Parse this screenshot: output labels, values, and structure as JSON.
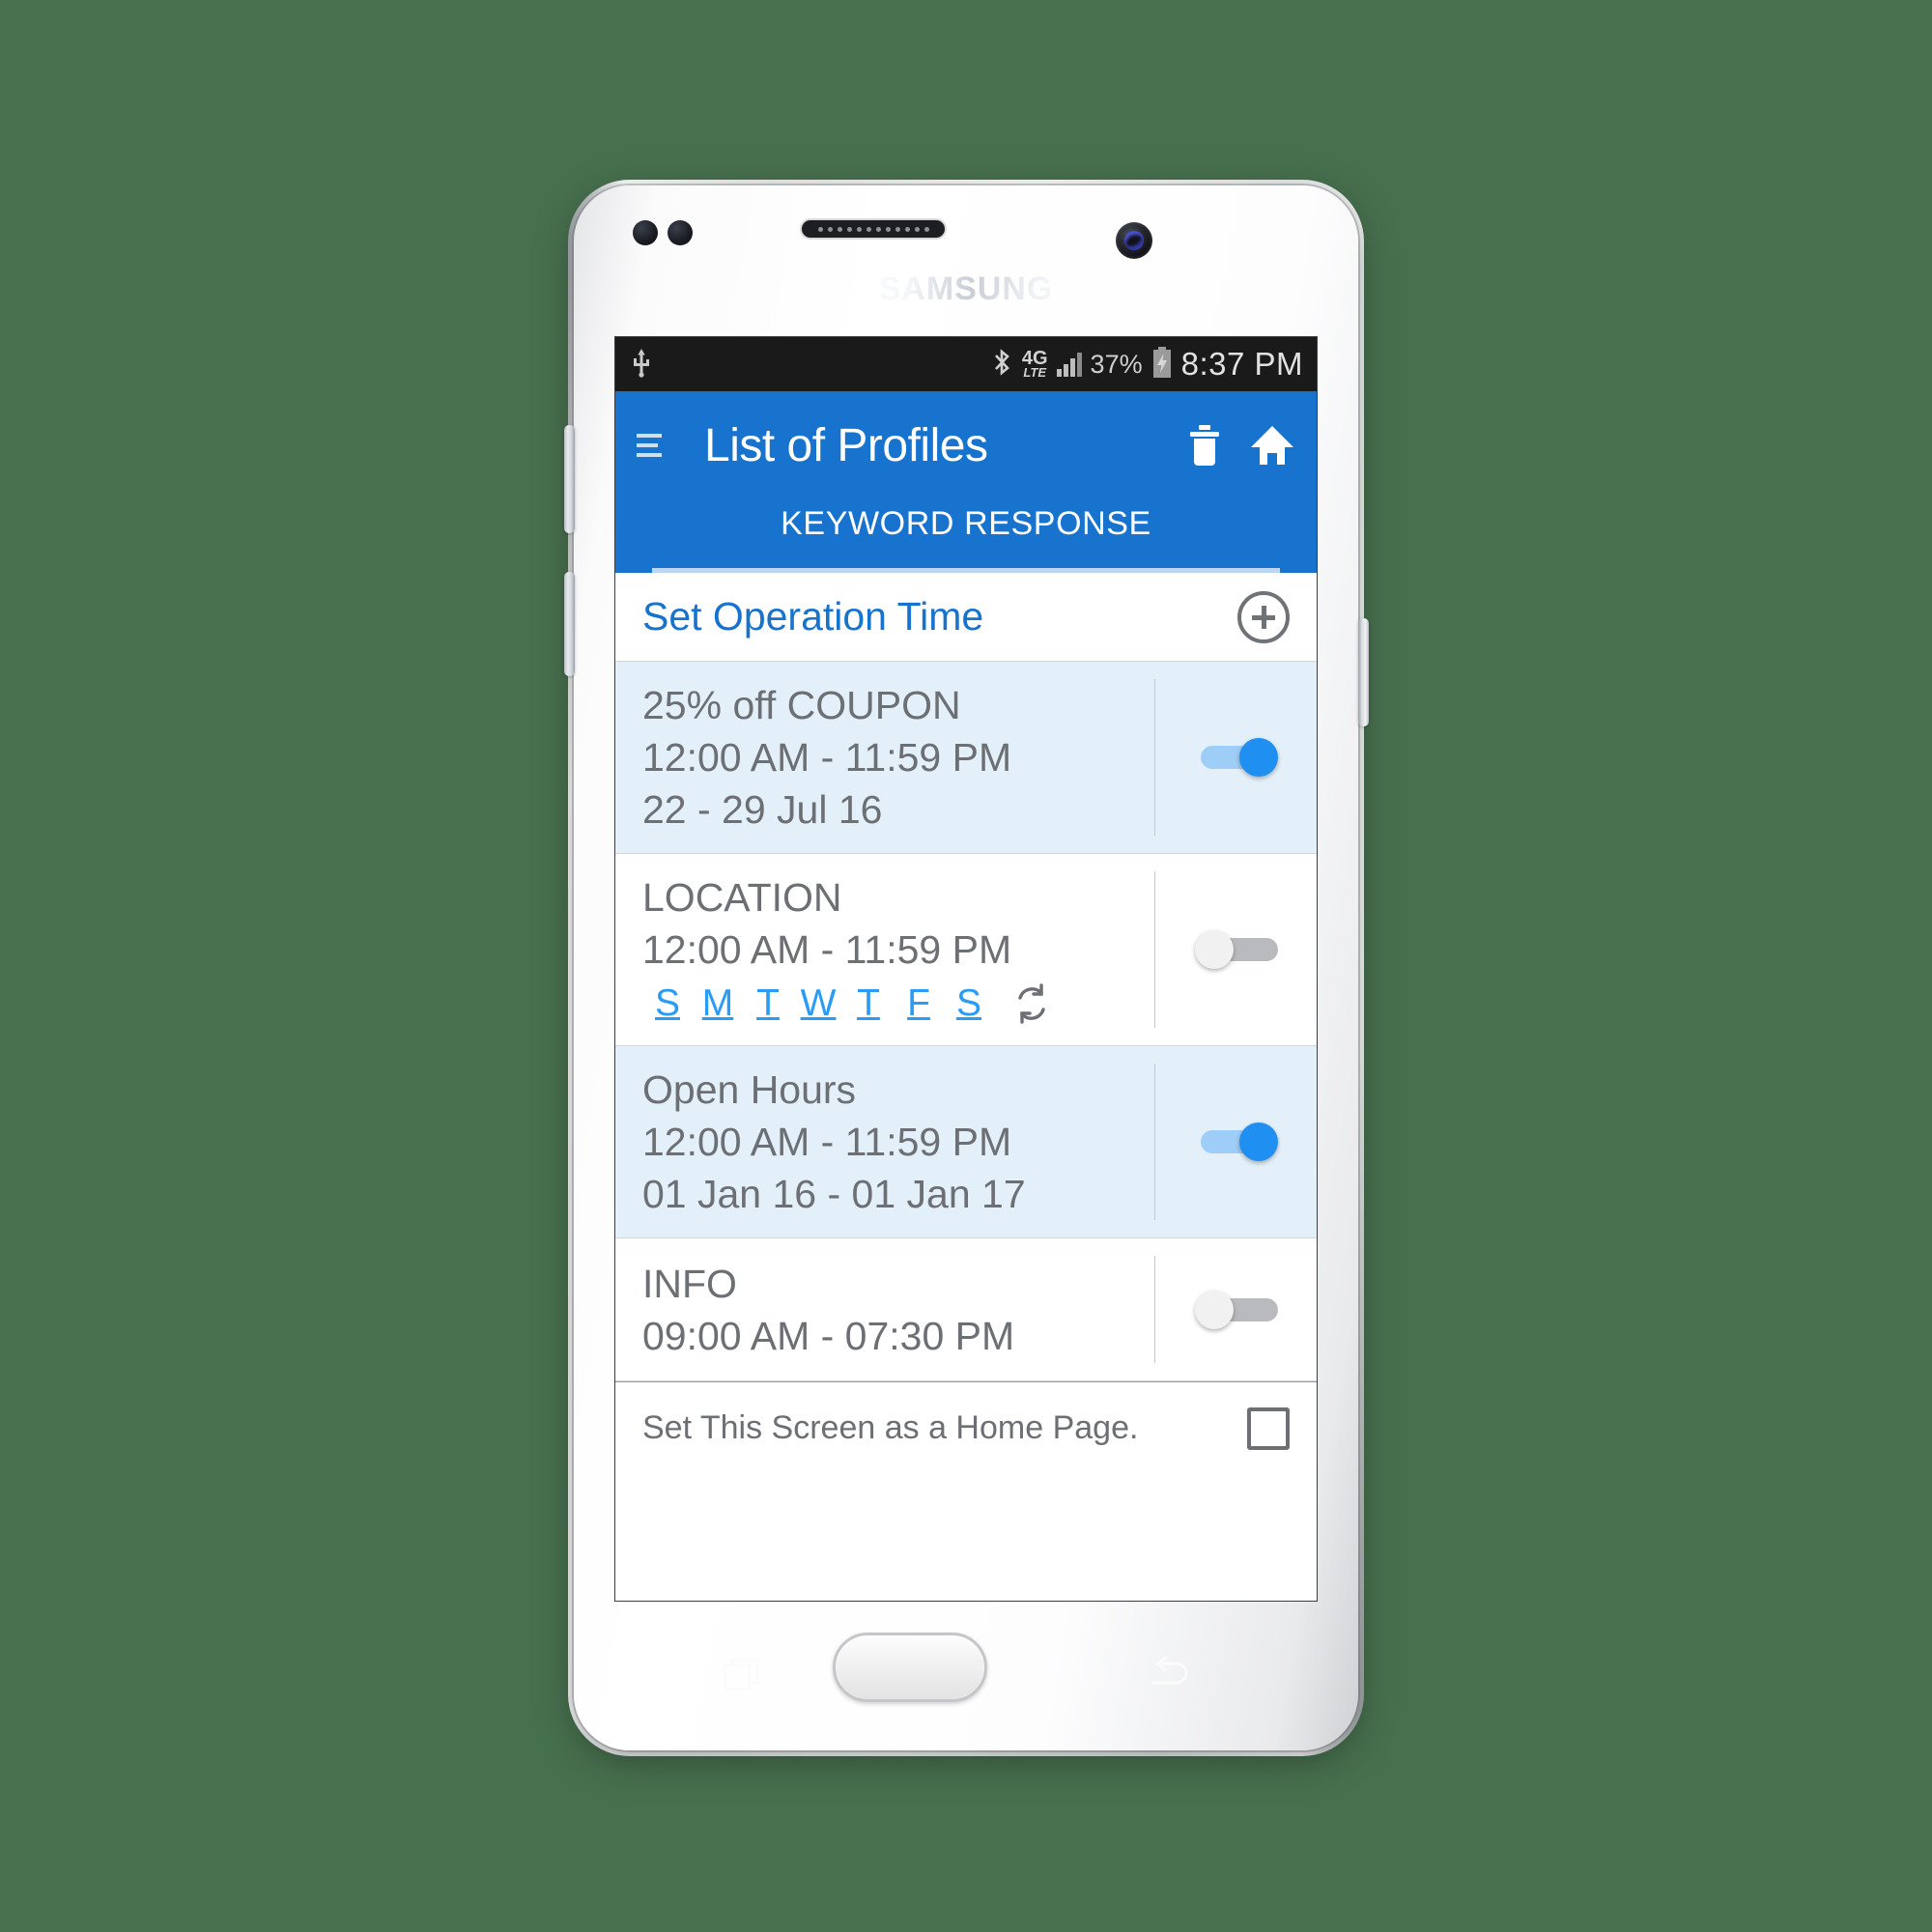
{
  "background_color": "#47704e",
  "phone": {
    "brand": "SAMSUNG",
    "hardware": {
      "earpiece": "speaker-grille",
      "front_camera": "front-camera",
      "sensors": [
        "proximity-sensor",
        "light-sensor"
      ],
      "buttons": [
        "volume-up",
        "volume-down",
        "power"
      ],
      "nav_buttons": [
        "recents",
        "home",
        "back"
      ]
    }
  },
  "status_bar": {
    "usb_icon": "usb-icon",
    "bluetooth_icon": "bluetooth-icon",
    "network_label_top": "4G",
    "network_label_bottom": "LTE",
    "signal_icon": "signal-bars-icon",
    "battery_percent": "37%",
    "battery_icon": "battery-charging-icon",
    "clock": "8:37 PM"
  },
  "app_bar": {
    "menu_icon": "hamburger-menu-icon",
    "title": "List of Profiles",
    "delete_icon": "trash-icon",
    "home_icon": "home-icon",
    "background_color": "#1773cd"
  },
  "tabs": {
    "active_label": "KEYWORD RESPONSE",
    "indicator_color": "#bcd7f1"
  },
  "set_operation": {
    "label": "Set Operation Time",
    "label_color": "#1773cd",
    "add_icon": "plus-circle-icon"
  },
  "profiles": [
    {
      "title": "25% off COUPON",
      "time": "12:00 AM - 11:59 PM",
      "date": "22 - 29 Jul 16",
      "days": null,
      "repeat_icon": null,
      "toggle": "on",
      "highlighted": true
    },
    {
      "title": "LOCATION",
      "time": "12:00 AM - 11:59 PM",
      "date": null,
      "days": [
        "S",
        "M",
        "T",
        "W",
        "T",
        "F",
        "S"
      ],
      "repeat_icon": "repeat-icon",
      "toggle": "off",
      "highlighted": false
    },
    {
      "title": "Open Hours",
      "time": "12:00 AM - 11:59 PM",
      "date": "01 Jan 16 - 01 Jan 17",
      "days": null,
      "repeat_icon": null,
      "toggle": "on",
      "highlighted": true
    },
    {
      "title": "INFO",
      "time": "09:00 AM - 07:30 PM",
      "date": null,
      "days": null,
      "repeat_icon": null,
      "toggle": "off",
      "highlighted": false
    }
  ],
  "footer": {
    "label": "Set This Screen as a Home Page.",
    "checkbox_checked": false
  },
  "colors": {
    "accent_blue": "#1773cd",
    "toggle_on": "#1f8ff2",
    "toggle_off": "#b8babd",
    "row_highlight": "#e3f0fa",
    "text_gray": "#6c6f73",
    "day_blue": "#2a9cf5"
  }
}
